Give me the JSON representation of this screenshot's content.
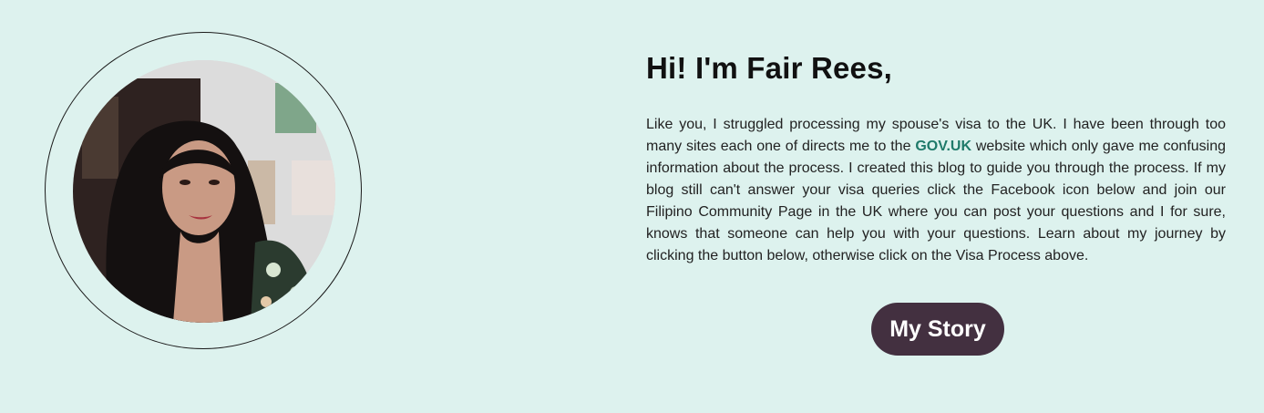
{
  "intro": {
    "heading": "Hi! I'm Fair Rees,",
    "text_before_link": "Like you, I struggled processing my spouse's visa to the UK. I have been through too many sites each one of directs me to the ",
    "link_label": "GOV.UK",
    "text_after_link": " website which only gave me confusing information about the process. I created this blog to guide you through the process. If my blog still can't answer your visa queries click the Facebook icon below and join our Filipino Community Page in the UK where you can post your questions and I for sure, knows that someone can help you with your questions. Learn about my journey by clicking the button below, otherwise click on the Visa Process above."
  },
  "button": {
    "label": "My Story"
  },
  "colors": {
    "background": "#ddf2ee",
    "button": "#433040",
    "link": "#1f7a6a"
  }
}
